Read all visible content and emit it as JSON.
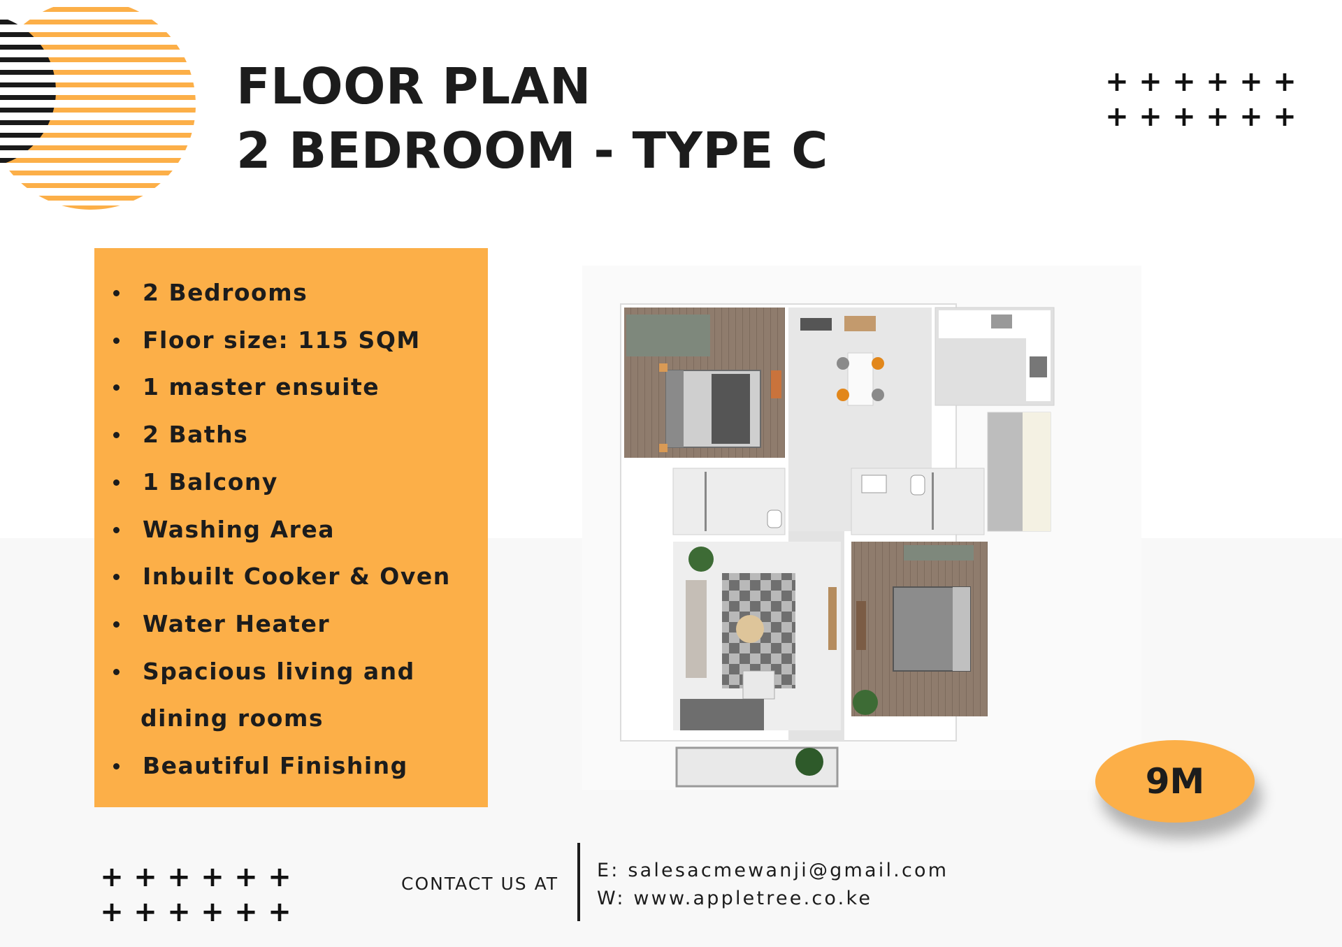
{
  "title": {
    "line1": "FLOOR PLAN",
    "line2": "2 BEDROOM - TYPE C"
  },
  "features": [
    "2 Bedrooms",
    "Floor size: 115 SQM",
    "1 master ensuite",
    "2 Baths",
    "1 Balcony",
    "Washing Area",
    "Inbuilt Cooker & Oven",
    "Water Heater",
    "Spacious living and",
    "dining rooms",
    "Beautiful Finishing"
  ],
  "price": "9M",
  "contact": {
    "label": "CONTACT US AT",
    "email": "E: salesacmewanji@gmail.com",
    "web": "W: www.appletree.co.ke"
  },
  "decor": {
    "plus_symbol": "+",
    "plus_icon": "plus-icon",
    "sun_icon": "striped-sun-icon"
  },
  "colors": {
    "accent": "#fcaf48",
    "text": "#1c1c1c",
    "background": "#ffffff",
    "floor_wood": "#8f7c6d",
    "floor_tile": "#e4e4e4"
  }
}
